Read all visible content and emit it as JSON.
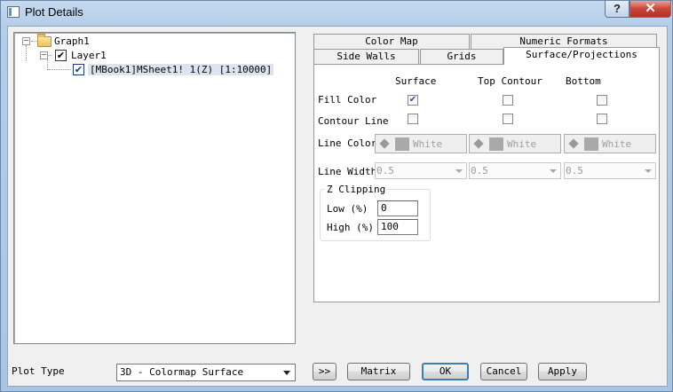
{
  "window": {
    "title": "Plot Details",
    "help_label": "?",
    "close_label": "✕"
  },
  "tree": {
    "graph": "Graph1",
    "layer": "Layer1",
    "plot": "[MBook1]MSheet1! 1(Z) [1:10000]",
    "expander_symbol": "−",
    "check_symbol": "✔"
  },
  "tabs": {
    "row1": [
      "Color Map",
      "Numeric Formats"
    ],
    "row2": [
      "Side Walls",
      "Grids",
      "Surface/Projections"
    ],
    "active": "Surface/Projections"
  },
  "panel": {
    "columns": [
      "Surface",
      "Top Contour",
      "Bottom"
    ],
    "rows": {
      "fill_color": "Fill Color",
      "contour_line": "Contour Line",
      "line_color": "Line Color",
      "line_width": "Line Width"
    },
    "fill_color_checks": [
      true,
      false,
      false
    ],
    "contour_line_checks": [
      false,
      false,
      false
    ],
    "line_colors": [
      "White",
      "White",
      "White"
    ],
    "line_widths": [
      "0.5",
      "0.5",
      "0.5"
    ],
    "z_clipping": {
      "title": "Z Clipping",
      "low_label": "Low  (%)",
      "low_value": "0",
      "high_label": "High (%)",
      "high_value": "100"
    }
  },
  "footer": {
    "plot_type_label": "Plot Type",
    "plot_type_value": "3D - Colormap Surface",
    "collapse_label": ">>",
    "matrix_label": "Matrix",
    "ok_label": "OK",
    "cancel_label": "Cancel",
    "apply_label": "Apply"
  }
}
